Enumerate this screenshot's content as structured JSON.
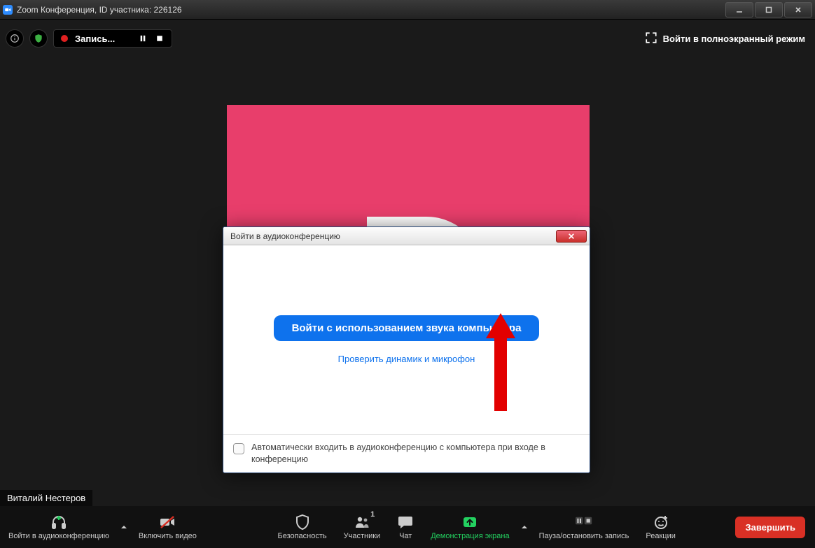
{
  "window": {
    "title": "Zoom Конференция, ID участника: 226126"
  },
  "toolbar": {
    "recording_label": "Запись...",
    "fullscreen_label": "Войти в полноэкранный режим"
  },
  "participant": {
    "name": "Виталий Нестеров"
  },
  "controls": {
    "audio": "Войти в аудиоконференцию",
    "video": "Включить видео",
    "security": "Безопасность",
    "participants": "Участники",
    "participants_count": "1",
    "chat": "Чат",
    "share": "Демонстрация экрана",
    "record": "Пауза/остановить запись",
    "reactions": "Реакции",
    "end": "Завершить"
  },
  "dialog": {
    "title": "Войти в аудиоконференцию",
    "primary": "Войти с использованием звука компьютера",
    "test_link": "Проверить динамик и микрофон",
    "auto_join": "Автоматически входить в аудиоконференцию с компьютера при входе в конференцию"
  },
  "colors": {
    "accent": "#0e72ed",
    "participant_bg": "#e83e6b",
    "end": "#d93025"
  }
}
